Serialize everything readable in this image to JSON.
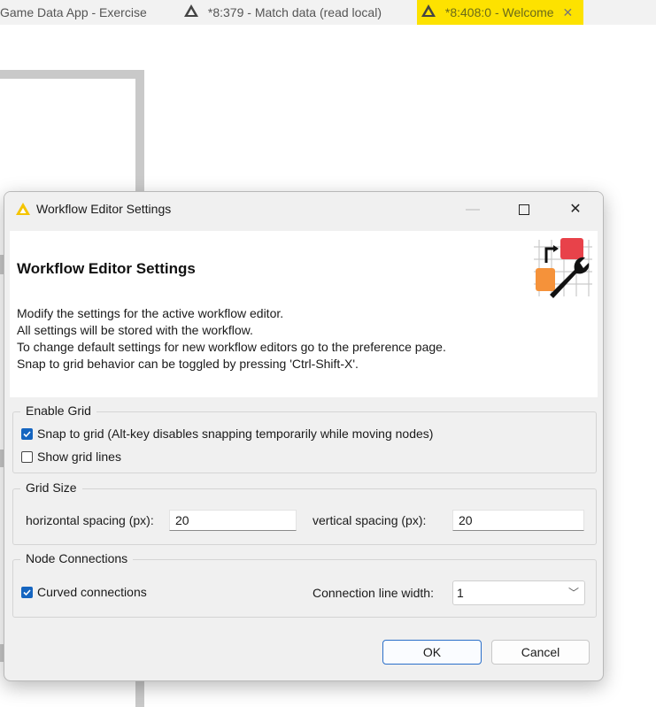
{
  "tabs": [
    {
      "label": "Game Data App - Exercise"
    },
    {
      "label": "*8:379 - Match data (read local)"
    },
    {
      "label": "*8:408:0 - Welcome"
    }
  ],
  "dialog": {
    "window_title": "Workflow Editor Settings",
    "header_title": "Workflow Editor Settings",
    "description": [
      "Modify the settings for the active workflow editor.",
      "All settings will be stored with the workflow.",
      "To change default settings for new workflow editors go to the preference page.",
      "Snap to grid behavior can be toggled by pressing 'Ctrl-Shift-X'."
    ],
    "enable_grid": {
      "legend": "Enable Grid",
      "snap_label": "Snap to grid (Alt-key disables snapping temporarily while moving nodes)",
      "snap_checked": true,
      "show_lines_label": "Show grid lines",
      "show_lines_checked": false
    },
    "grid_size": {
      "legend": "Grid Size",
      "h_label": "horizontal spacing (px):",
      "h_value": "20",
      "v_label": "vertical spacing (px):",
      "v_value": "20"
    },
    "node_connections": {
      "legend": "Node Connections",
      "curved_label": "Curved connections",
      "curved_checked": true,
      "width_label": "Connection line width:",
      "width_value": "1"
    },
    "ok_label": "OK",
    "cancel_label": "Cancel"
  },
  "colors": {
    "accent": "#1565c0",
    "active_tab": "#fde200",
    "warning": "#f5c400"
  }
}
